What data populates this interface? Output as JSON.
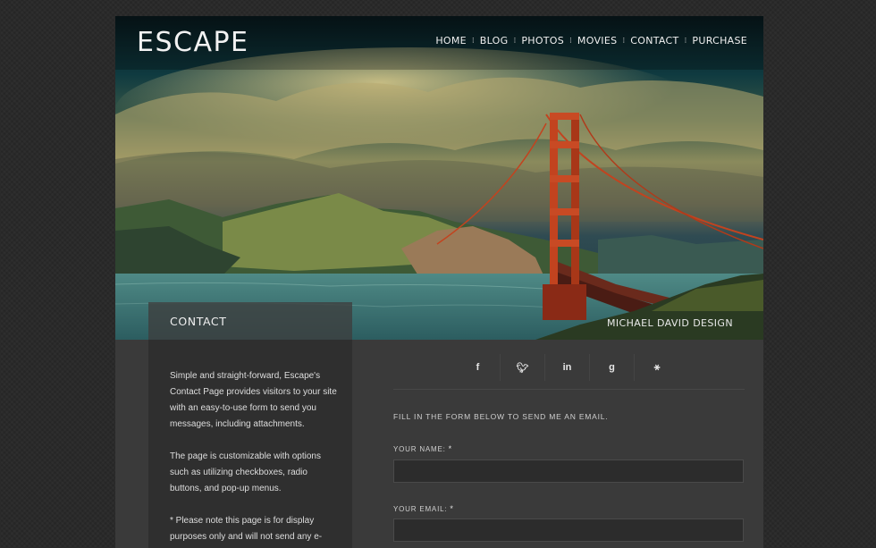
{
  "site": {
    "logo": "ESCAPE",
    "credit": "MICHAEL DAVID DESIGN"
  },
  "nav": {
    "items": [
      "HOME",
      "BLOG",
      "PHOTOS",
      "MOVIES",
      "CONTACT",
      "PURCHASE"
    ],
    "separator": "⁝"
  },
  "sidebar": {
    "title": "CONTACT",
    "paragraphs": [
      "Simple and straight-forward, Escape's Contact Page provides visitors to your site with an easy-to-use form to send you messages, including attachments.",
      "The page is customizable with options such as utilizing checkboxes, radio buttons, and pop-up menus.",
      "* Please note this page is for display purposes only and will not send any e-"
    ]
  },
  "social": [
    {
      "icon": "facebook-icon",
      "glyph": "f"
    },
    {
      "icon": "twitter-icon",
      "glyph": "🐦︎"
    },
    {
      "icon": "linkedin-icon",
      "glyph": "in"
    },
    {
      "icon": "google-icon",
      "glyph": "g"
    },
    {
      "icon": "delicious-icon",
      "glyph": "⚹"
    }
  ],
  "form": {
    "intro": "FILL IN THE FORM BELOW TO SEND ME AN EMAIL.",
    "required_mark": "*",
    "name_label": "YOUR NAME:",
    "name_value": "",
    "email_label": "YOUR EMAIL:",
    "email_value": ""
  },
  "colors": {
    "accent_bridge": "#c2431f",
    "sky_teal": "#0f3a40",
    "panel_dark": "#2f2f2f"
  }
}
